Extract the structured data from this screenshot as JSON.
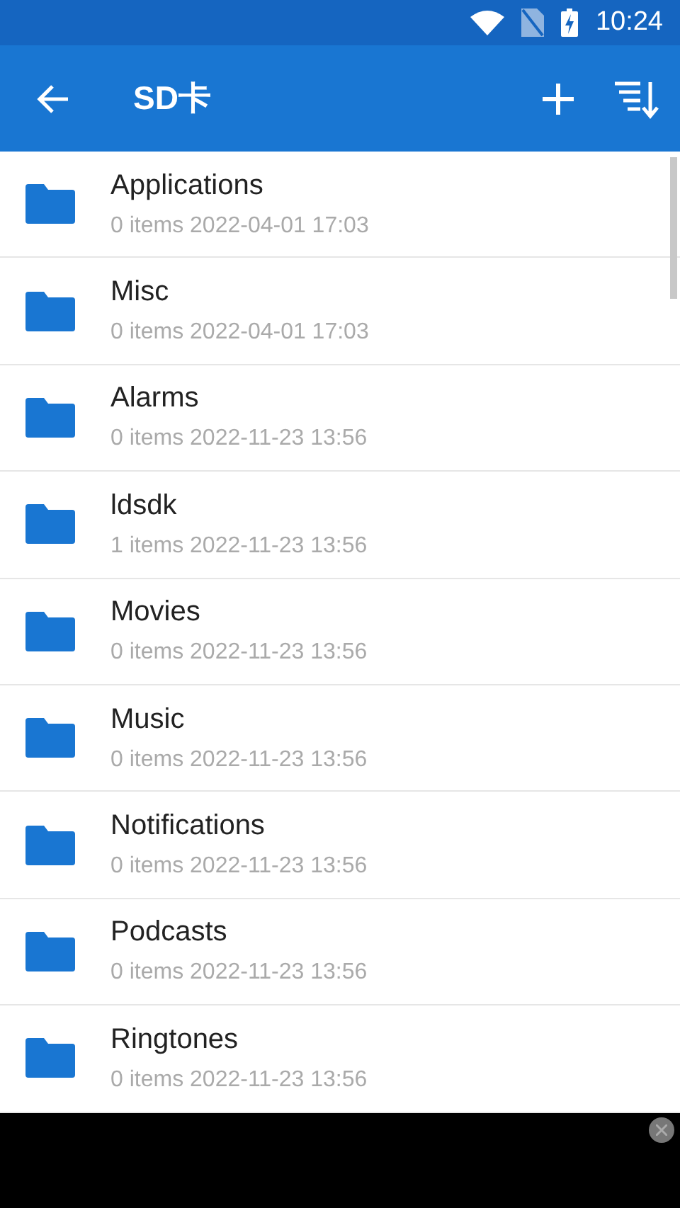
{
  "status_bar": {
    "time": "10:24"
  },
  "toolbar": {
    "title": "SD卡"
  },
  "files": [
    {
      "name": "Applications",
      "details": "0 items 2022-04-01 17:03"
    },
    {
      "name": "Misc",
      "details": "0 items 2022-04-01 17:03"
    },
    {
      "name": "Alarms",
      "details": "0 items 2022-11-23 13:56"
    },
    {
      "name": "ldsdk",
      "details": "1 items 2022-11-23 13:56"
    },
    {
      "name": "Movies",
      "details": "0 items 2022-11-23 13:56"
    },
    {
      "name": "Music",
      "details": "0 items 2022-11-23 13:56"
    },
    {
      "name": "Notifications",
      "details": "0 items 2022-11-23 13:56"
    },
    {
      "name": "Podcasts",
      "details": "0 items 2022-11-23 13:56"
    },
    {
      "name": "Ringtones",
      "details": "0 items 2022-11-23 13:56"
    }
  ]
}
